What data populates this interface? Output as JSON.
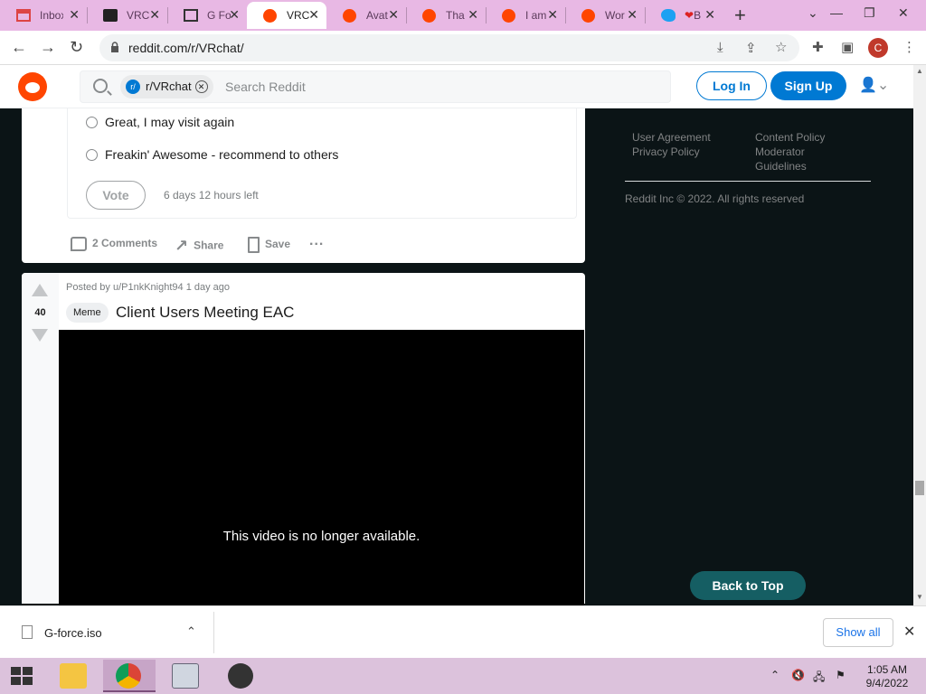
{
  "browser": {
    "tabs": [
      {
        "label": "Inbox",
        "favicon": "gmail-icon"
      },
      {
        "label": "VRChat",
        "favicon": "vrchat-icon"
      },
      {
        "label": "G Fo",
        "favicon": "museum-icon"
      },
      {
        "label": "VRC",
        "favicon": "reddit-icon",
        "active": true
      },
      {
        "label": "Avat",
        "favicon": "reddit-icon"
      },
      {
        "label": "Tha",
        "favicon": "reddit-icon"
      },
      {
        "label": "I am",
        "favicon": "reddit-icon"
      },
      {
        "label": "Wor",
        "favicon": "reddit-icon"
      },
      {
        "label": "B",
        "favicon": "twitter-icon"
      }
    ],
    "url": "reddit.com/r/VRchat/",
    "profile_initial": "C"
  },
  "reddit": {
    "search": {
      "subreddit_chip": "r/VRchat",
      "placeholder": "Search Reddit"
    },
    "login_label": "Log In",
    "signup_label": "Sign Up"
  },
  "poll": {
    "options": [
      "Great, I may visit again",
      "Freakin' Awesome - recommend to others"
    ],
    "vote_label": "Vote",
    "time_left": "6 days 12 hours left"
  },
  "post1_actions": {
    "comments": "2 Comments",
    "share": "Share",
    "save": "Save",
    "more": "..."
  },
  "post2": {
    "score": "40",
    "meta": "Posted by u/P1nkKnight94 1 day ago",
    "flair": "Meme",
    "title": "Client Users Meeting EAC",
    "video_message": "This video is no longer available."
  },
  "sidebar": {
    "links": [
      "User Agreement",
      "Privacy Policy",
      "Content Policy",
      "Moderator",
      "Guidelines"
    ],
    "copyright": "Reddit Inc © 2022. All rights reserved",
    "back_to_top": "Back to Top"
  },
  "downloads": {
    "file_name": "G-force.iso",
    "show_all": "Show all"
  },
  "taskbar": {
    "time": "1:05 AM",
    "date": "9/4/2022"
  }
}
